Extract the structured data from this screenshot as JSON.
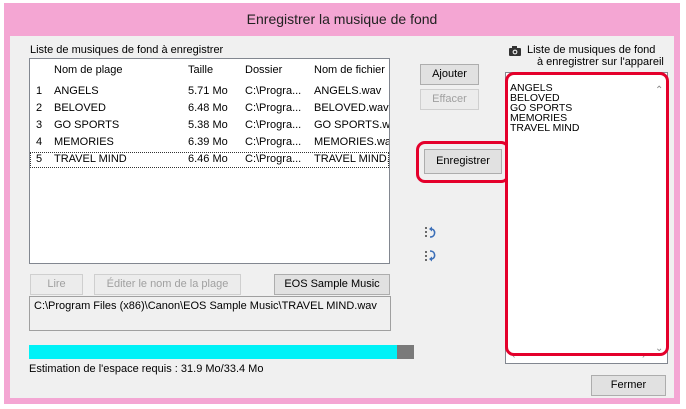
{
  "window": {
    "title": "Enregistrer la musique de fond"
  },
  "left_panel": {
    "heading": "Liste de musiques de fond à enregistrer",
    "columns": [
      "Nom de plage",
      "Taille",
      "Dossier",
      "Nom de fichier"
    ],
    "rows": [
      {
        "num": "1",
        "name": "ANGELS",
        "size": "5.71 Mo",
        "folder": "C:\\Progra...",
        "file": "ANGELS.wav"
      },
      {
        "num": "2",
        "name": "BELOVED",
        "size": "6.48 Mo",
        "folder": "C:\\Progra...",
        "file": "BELOVED.wav"
      },
      {
        "num": "3",
        "name": "GO SPORTS",
        "size": "5.38 Mo",
        "folder": "C:\\Progra...",
        "file": "GO SPORTS.wav"
      },
      {
        "num": "4",
        "name": "MEMORIES",
        "size": "6.39 Mo",
        "folder": "C:\\Progra...",
        "file": "MEMORIES.wav"
      },
      {
        "num": "5",
        "name": "TRAVEL MIND",
        "size": "6.46 Mo",
        "folder": "C:\\Progra...",
        "file": "TRAVEL MIND.w..."
      }
    ],
    "selected_row": "5",
    "buttons": {
      "play": "Lire",
      "edit_track_name": "Éditer le nom de la plage",
      "eos_sample_music": "EOS Sample Music"
    },
    "selected_path": "C:\\Program Files (x86)\\Canon\\EOS Sample Music\\TRAVEL MIND.wav",
    "progress_fraction": 0.955,
    "progress_color": "#00f2f7",
    "space_estimate": "Estimation de l'espace requis : 31.9 Mo/33.4 Mo"
  },
  "middle_buttons": {
    "add": "Ajouter",
    "delete": "Effacer",
    "register": "Enregistrer"
  },
  "right_panel": {
    "heading_line1": "Liste de musiques de fond",
    "heading_line2": "à enregistrer sur l'appareil",
    "icon": "camera-icon",
    "items": [
      "ANGELS",
      "BELOVED",
      "GO SPORTS",
      "MEMORIES",
      "TRAVEL MIND"
    ]
  },
  "footer": {
    "close": "Fermer"
  },
  "colors": {
    "title_bar": "#f4a6d3",
    "highlight_ring": "#e4002b"
  }
}
